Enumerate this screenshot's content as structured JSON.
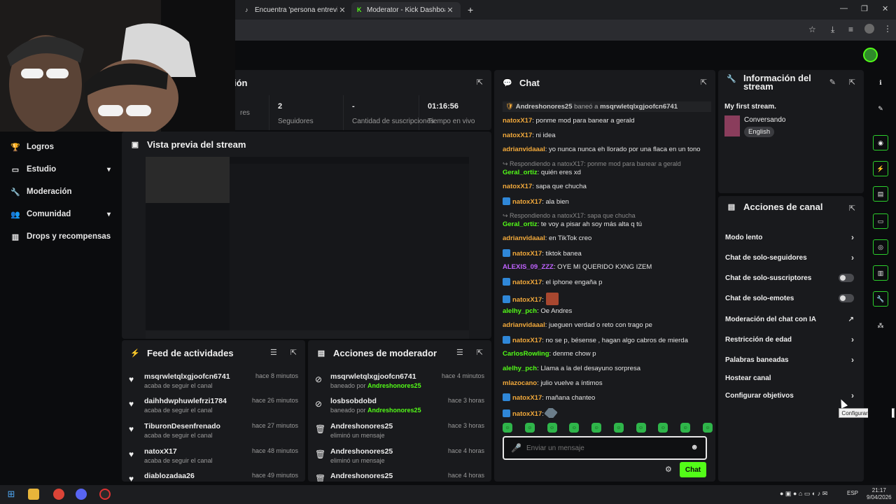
{
  "browser": {
    "tabs": [
      {
        "title": "Encuentra 'persona entrevista c",
        "icon": "tiktok-icon"
      },
      {
        "title": "Moderator - Kick Dashboard",
        "icon": "kick-icon"
      }
    ],
    "new_tab": "+"
  },
  "sidebar": {
    "items": [
      {
        "label": "Logros",
        "icon": "trophy-icon"
      },
      {
        "label": "Estudio",
        "icon": "studio-icon",
        "chevron": true
      },
      {
        "label": "Moderación",
        "icon": "wrench-icon"
      },
      {
        "label": "Comunidad",
        "icon": "community-icon",
        "chevron": true
      },
      {
        "label": "Drops y recompensas",
        "icon": "drops-icon"
      }
    ]
  },
  "stats_panel": {
    "title_partial": "ión",
    "stats": [
      {
        "value": "",
        "label": "res"
      },
      {
        "value": "2",
        "label": "Seguidores"
      },
      {
        "value": "-",
        "label": "Cantidad de suscripciones"
      },
      {
        "value": "01:16:56",
        "label": "Tiempo en vivo"
      }
    ]
  },
  "preview_panel": {
    "title": "Vista previa del stream"
  },
  "activity_feed": {
    "title": "Feed de actividades",
    "items": [
      {
        "name": "msqrwletqlxgjoofcn6741",
        "desc": "acaba de seguir el canal",
        "time": "hace 8 minutos"
      },
      {
        "name": "daihhdwphuwlefrzi1784",
        "desc": "acaba de seguir el canal",
        "time": "hace 26 minutos"
      },
      {
        "name": "TiburonDesenfrenado",
        "desc": "acaba de seguir el canal",
        "time": "hace 27 minutos"
      },
      {
        "name": "natoxX17",
        "desc": "acaba de seguir el canal",
        "time": "hace 48 minutos"
      },
      {
        "name": "diablozadaa26",
        "desc": "",
        "time": "hace 49 minutos"
      }
    ]
  },
  "mod_actions": {
    "title": "Acciones de moderador",
    "items": [
      {
        "name": "msqrwletqlxgjoofcn6741",
        "desc": "baneado por ",
        "by": "Andreshonores25",
        "time": "hace 4 minutos",
        "icon": "ban-icon"
      },
      {
        "name": "losbsobdobd",
        "desc": "baneado por ",
        "by": "Andreshonores25",
        "time": "hace 3 horas",
        "icon": "ban-icon"
      },
      {
        "name": "Andreshonores25",
        "desc": "eliminó un mensaje",
        "by": "",
        "time": "hace 3 horas",
        "icon": "trash-icon"
      },
      {
        "name": "Andreshonores25",
        "desc": "eliminó un mensaje",
        "by": "",
        "time": "hace 4 horas",
        "icon": "trash-icon"
      },
      {
        "name": "Andreshonores25",
        "desc": "",
        "by": "",
        "time": "hace 4 horas",
        "icon": "trash-icon"
      }
    ]
  },
  "chat": {
    "title": "Chat",
    "ban_notice": {
      "moderator": "Andreshonores25",
      "text": " baneó a ",
      "target": "msqrwletqlxgjoofcn6741"
    },
    "messages": [
      {
        "user": "natoxX17",
        "color": "#f2a93b",
        "badge": false,
        "text": ": ponme mod para banear a gerald"
      },
      {
        "user": "natoxX17",
        "color": "#f2a93b",
        "badge": false,
        "text": ": ni idea"
      },
      {
        "user": "adrianvidaaal",
        "color": "#f2a93b",
        "badge": false,
        "text": ": yo nunca nunca eh llorado por una flaca en un tono"
      },
      {
        "reply": "Respondiendo a natoxX17: ponme mod para banear a gerald",
        "user": "Geral_ortiz",
        "color": "#53fc18",
        "badge": false,
        "text": ": quién eres xd"
      },
      {
        "user": "natoxX17",
        "color": "#f2a93b",
        "badge": false,
        "text": ": sapa que chucha"
      },
      {
        "user": "natoxX17",
        "color": "#f2a93b",
        "badge": true,
        "text": ": ala bien"
      },
      {
        "reply": "Respondiendo a natoxX17: sapa que chucha",
        "user": "Geral_ortiz",
        "color": "#53fc18",
        "badge": false,
        "text": ": te voy a pisar ah soy más alta q tú"
      },
      {
        "user": "adrianvidaaal",
        "color": "#f2a93b",
        "badge": false,
        "text": ": en TikTok creo"
      },
      {
        "user": "natoxX17",
        "color": "#f2a93b",
        "badge": true,
        "text": ": tiktok banea"
      },
      {
        "user": "ALEXIS_09_ZZZ",
        "color": "#c062ff",
        "badge": false,
        "text": ": OYE MI QUERIDO KXNG IZEM"
      },
      {
        "user": "natoxX17",
        "color": "#f2a93b",
        "badge": true,
        "text": ": el iphone engaña p"
      },
      {
        "user": "natoxX17",
        "color": "#f2a93b",
        "badge": true,
        "text": ": ",
        "emote": "emote"
      },
      {
        "user": "alelhy_pch",
        "color": "#53fc18",
        "badge": false,
        "text": ": Oe Andres"
      },
      {
        "user": "adrianvidaaal",
        "color": "#f2a93b",
        "badge": false,
        "text": ": jueguen verdad o reto con trago pe"
      },
      {
        "user": "natoxX17",
        "color": "#f2a93b",
        "badge": true,
        "text": ": no se p, bésense , hagan algo cabros de mierda"
      },
      {
        "user": "CarlosRowling",
        "color": "#53fc18",
        "badge": false,
        "text": ": denme chow p"
      },
      {
        "user": "alelhy_pch",
        "color": "#53fc18",
        "badge": false,
        "text": ": Llama a la del desayuno sorpresa"
      },
      {
        "user": "mlazocano",
        "color": "#f2a93b",
        "badge": false,
        "text": ": julio vuelve a íntimos"
      },
      {
        "user": "natoxX17",
        "color": "#f2a93b",
        "badge": true,
        "text": ": mañana chanteo"
      },
      {
        "user": "natoxX17",
        "color": "#f2a93b",
        "badge": true,
        "text": ": ",
        "emote": "emote2"
      }
    ],
    "input_placeholder": "Enviar un mensaje",
    "send_label": "Chat"
  },
  "stream_info": {
    "title": "Información del stream",
    "stream_title": "My first stream.",
    "category": "Conversando",
    "language": "English"
  },
  "channel_actions": {
    "title": "Acciones de canal",
    "items": [
      {
        "label": "Modo lento",
        "control": "chevron"
      },
      {
        "label": "Chat de solo-seguidores",
        "control": "chevron"
      },
      {
        "label": "Chat de solo-suscriptores",
        "control": "toggle"
      },
      {
        "label": "Chat de solo-emotes",
        "control": "toggle"
      },
      {
        "label": "Moderación del chat con IA",
        "control": "external"
      },
      {
        "label": "Restricción de edad",
        "control": "chevron"
      },
      {
        "label": "Palabras baneadas",
        "control": "chevron"
      },
      {
        "label": "Hostear canal",
        "control": "none"
      },
      {
        "label": "Configurar objetivos",
        "control": "chevron"
      }
    ],
    "tooltip": "Configurar objetivos"
  },
  "taskbar": {
    "clock_time": "21:17",
    "clock_date": "9/04/2026",
    "lang": "ESP"
  },
  "colors": {
    "accent": "#53fc18",
    "panel": "#191a1d",
    "background": "#0b0c0e"
  }
}
